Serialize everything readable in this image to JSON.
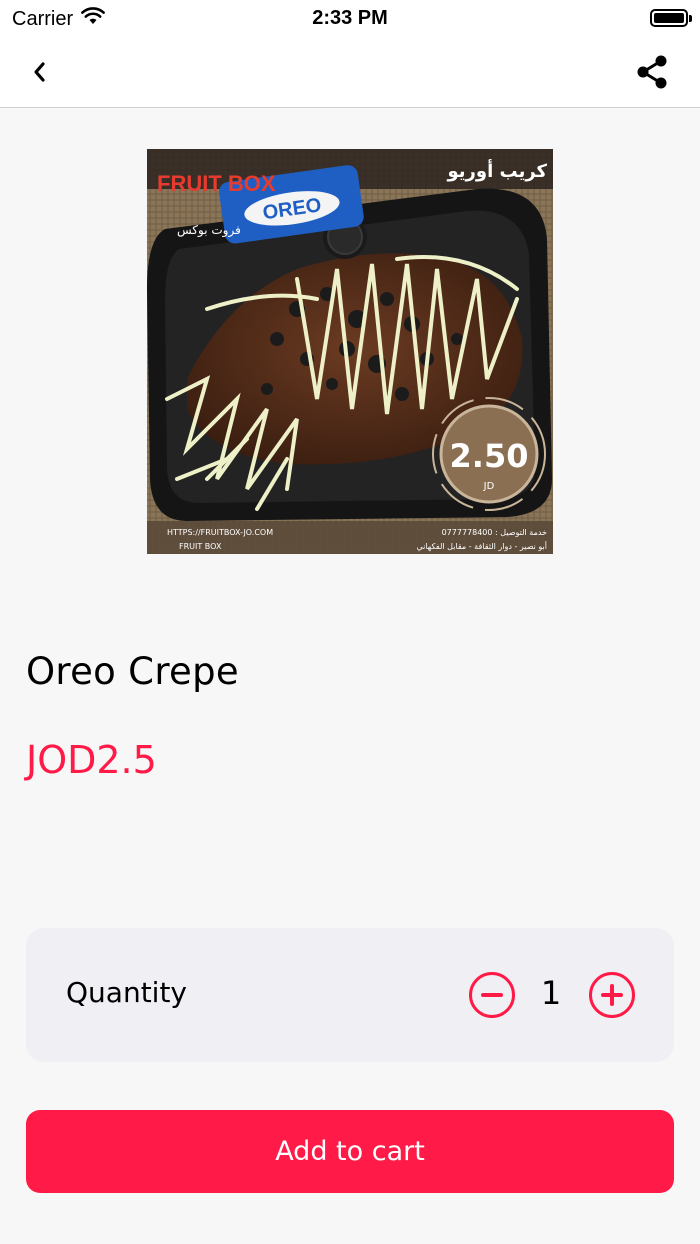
{
  "status_bar": {
    "carrier": "Carrier",
    "time": "2:33 PM",
    "icons": [
      "wifi-icon",
      "battery-icon"
    ]
  },
  "nav": {
    "icons": {
      "back": "chevron-left-icon",
      "share": "share-icon"
    }
  },
  "product": {
    "name": "Oreo Crepe",
    "price": "JOD2.5",
    "image": {
      "title": "كريب أوريو",
      "brand": "FRUIT BOX",
      "brand_ar": "فروت بوكس",
      "package_text": "OREO",
      "price_value": "2.50",
      "price_unit": "JD",
      "website": "HTTPS://FRUITBOX-JO.COM",
      "social": "FRUIT BOX",
      "delivery": "خدمة التوصيل : 0777778400",
      "address": "أبو نصير - دوار الثقافة - مقابل الفكهاني"
    }
  },
  "quantity": {
    "label": "Quantity",
    "value": "1"
  },
  "cart": {
    "label": "Add to cart"
  },
  "colors": {
    "accent": "#ff1a47",
    "background": "#f7f7f7",
    "card": "#f0eff4"
  }
}
